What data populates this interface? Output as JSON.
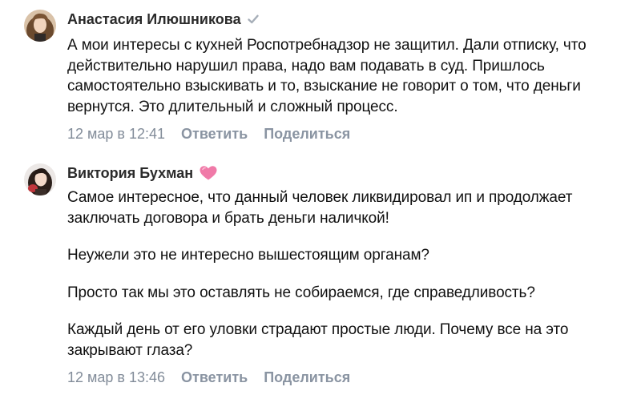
{
  "comments": [
    {
      "author": "Анастасия Илюшникова",
      "badge_icon": "verified-check-icon",
      "paragraphs": [
        "А мои интересы с кухней Роспотребнадзор не защитил. Дали отписку, что действительно нарушил права, надо вам подавать в суд. Пришлось самостоятельно взыскивать и то, взыскание не говорит о том, что деньги вернутся. Это длительный и сложный процесс."
      ],
      "time": "12 мар в 12:41",
      "reply_label": "Ответить",
      "share_label": "Поделиться"
    },
    {
      "author": "Виктория Бухман",
      "badge_icon": "pink-heart-icon",
      "paragraphs": [
        "Самое интересное, что данный человек ликвидировал ип и продолжает заключать договора и брать деньги наличкой!",
        "Неужели это не интересно вышестоящим органам?",
        "Просто так мы это оставлять не собираемся, где справедливость?",
        "Каждый день от его уловки страдают простые люди. Почему все на это закрывают глаза?"
      ],
      "time": "12 мар в 13:46",
      "reply_label": "Ответить",
      "share_label": "Поделиться"
    }
  ],
  "colors": {
    "meta": "#828c99",
    "heart": "#f07aa8",
    "check": "#a6aeb8"
  }
}
